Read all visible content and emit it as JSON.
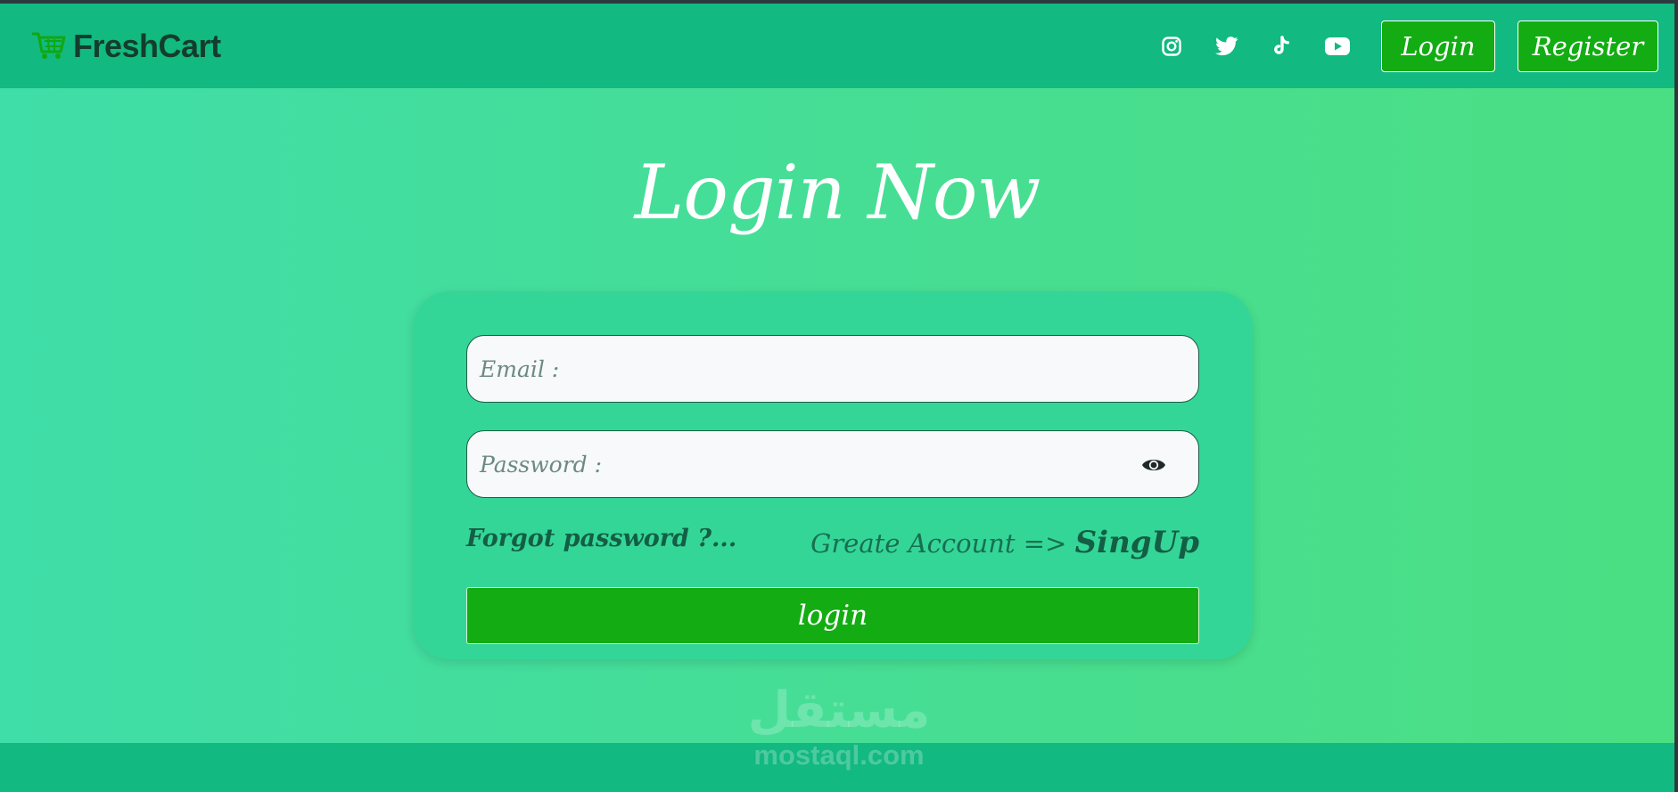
{
  "navbar": {
    "brand": "FreshCart",
    "icons": [
      "cart-icon",
      "instagram-icon",
      "twitter-icon",
      "tiktok-icon",
      "youtube-icon"
    ],
    "login_label": "Login",
    "register_label": "Register"
  },
  "main": {
    "title": "Login Now",
    "email_placeholder": "Email :",
    "password_placeholder": "Password :",
    "forgot_label": "Forgot password ?...",
    "create_label": "Greate Account =>",
    "signup_label": "SingUp",
    "submit_label": "login"
  },
  "watermark": {
    "arabic": "مستقل",
    "domain": "mostaql.com"
  },
  "colors": {
    "navbar": "#12b981",
    "button": "#13ad13",
    "card": "#34d698",
    "brand_text": "#133d2c",
    "cart_icon": "#11a711"
  }
}
